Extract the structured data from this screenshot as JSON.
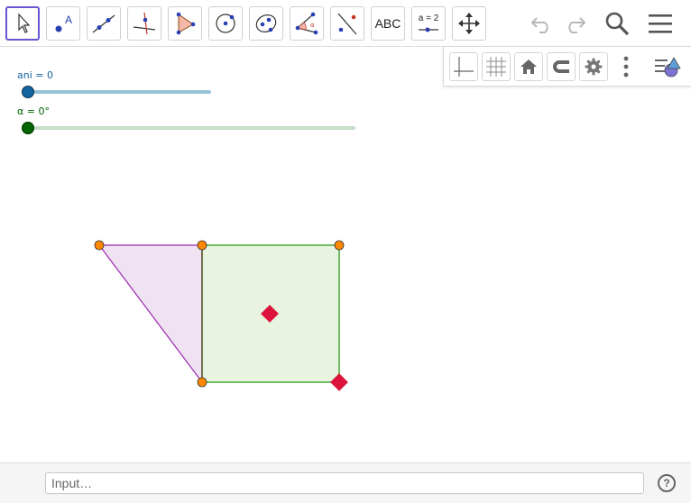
{
  "toolbar": {
    "tools": [
      {
        "name": "move-tool",
        "icon": "pointer-icon"
      },
      {
        "name": "point-tool",
        "icon": "point-icon",
        "label": "A"
      },
      {
        "name": "line-tool",
        "icon": "line-icon"
      },
      {
        "name": "perpendicular-line-tool",
        "icon": "perpendicular-icon"
      },
      {
        "name": "polygon-tool",
        "icon": "polygon-icon"
      },
      {
        "name": "circle-tool",
        "icon": "circle-icon"
      },
      {
        "name": "ellipse-tool",
        "icon": "ellipse-icon"
      },
      {
        "name": "angle-tool",
        "icon": "angle-icon",
        "label": "α"
      },
      {
        "name": "reflect-tool",
        "icon": "reflect-icon"
      },
      {
        "name": "text-tool",
        "icon": "text-icon",
        "label": "ABC"
      },
      {
        "name": "slider-tool",
        "icon": "slider-icon",
        "label": "a = 2"
      },
      {
        "name": "move-graphics-tool",
        "icon": "move-arrows-icon"
      }
    ],
    "right": [
      "undo-icon",
      "redo-icon",
      "search-icon",
      "menu-icon"
    ]
  },
  "stylebar": {
    "buttons": [
      "axes-icon",
      "grid-icon",
      "home-icon",
      "magnet-icon",
      "gear-icon",
      "more-icon",
      "style-toggle-icon"
    ]
  },
  "sliders": [
    {
      "label": "ani = 0",
      "value": 0,
      "color": "#1565a0",
      "track_color": "#96c2d8"
    },
    {
      "label": "α = 0°",
      "value": 0,
      "color": "#006400",
      "track_color": "#c5dcc5"
    }
  ],
  "geometry": {
    "triangle_fill": "#efe3f1",
    "triangle_stroke": "#9c27b0",
    "square_fill": "#e8f3e0",
    "square_stroke": "#44aa33",
    "point_color": "#ff8800",
    "diamond_color": "#dc143c"
  },
  "inputbar": {
    "placeholder": "Input…",
    "help": "?"
  }
}
